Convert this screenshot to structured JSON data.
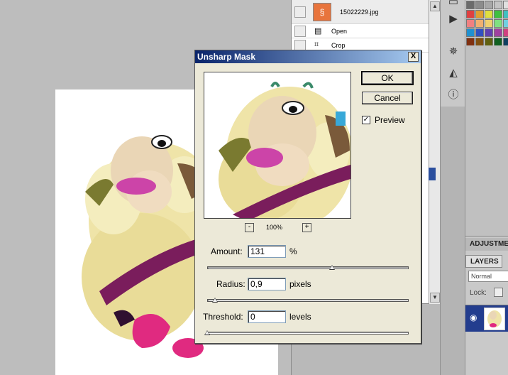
{
  "history": {
    "snapshot_name": "15022229.jpg",
    "items": [
      {
        "label": "Open",
        "icon": "document-icon"
      },
      {
        "label": "Crop",
        "icon": "crop-icon"
      }
    ]
  },
  "dialog": {
    "title": "Unsharp Mask",
    "close_label": "X",
    "ok_label": "OK",
    "cancel_label": "Cancel",
    "preview_label": "Preview",
    "preview_checked": true,
    "preview_check_mark": "✓",
    "zoom": {
      "minus": "-",
      "plus": "+",
      "level": "100%"
    },
    "amount": {
      "label": "Amount:",
      "value": "131",
      "unit": "%",
      "slider_fraction": 0.62
    },
    "radius": {
      "label": "Radius:",
      "value": "0,9",
      "unit": "pixels",
      "slider_fraction": 0.04
    },
    "threshold": {
      "label": "Threshold:",
      "value": "0",
      "unit": "levels",
      "slider_fraction": 0.0
    }
  },
  "layers": {
    "adjustments_tab": "ADJUSTME",
    "layers_tab": "LAYERS",
    "blend_mode": "Normal",
    "lock_label": "Lock:"
  },
  "swatch_colors": [
    "#6b6b6b",
    "#8c8c8c",
    "#a8a8a8",
    "#c4c4c4",
    "#e0e0e0",
    "#e04040",
    "#e0a030",
    "#e0e040",
    "#40c040",
    "#40c0c0",
    "#f08080",
    "#f0b070",
    "#f0d070",
    "#80e080",
    "#70d0e0",
    "#2090d0",
    "#3050c0",
    "#6040b0",
    "#a040a0",
    "#d04080",
    "#803010",
    "#805010",
    "#606010",
    "#106020",
    "#104060"
  ],
  "theme": {
    "titlebar_start": "#0a246a",
    "titlebar_end": "#a6caf0",
    "dialog_bg": "#ece9d8",
    "layer_selected": "#233d8e"
  }
}
